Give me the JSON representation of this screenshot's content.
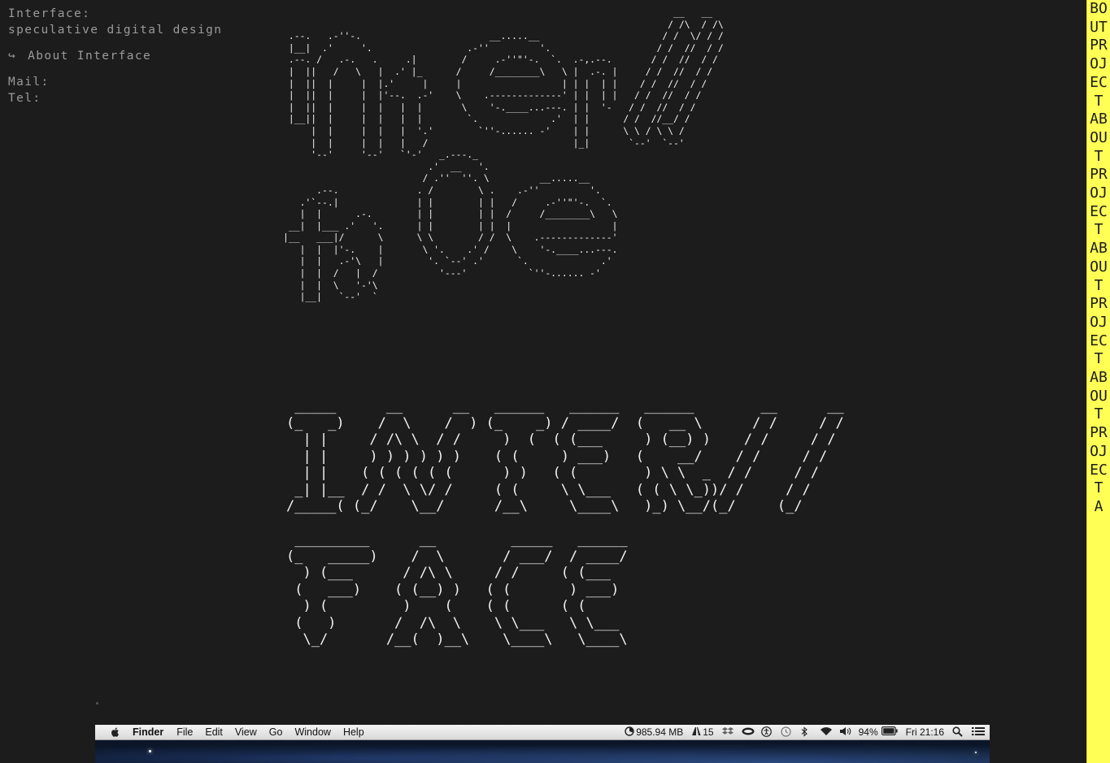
{
  "info": {
    "title": "Interface:",
    "subtitle": "speculative digital design",
    "about_arrow": "↪",
    "about_label": "About Interface",
    "mail_label": "Mail:",
    "tel_label": "Tel:"
  },
  "art": {
    "small": "                                                                      __   __\n                                                                     / /\\  / /\\\n .--.   .-''-.                       __.....__                      / /  \\/ / /\n |__|  .'     '.                 .-''         '.                   / /  //  / /\n .--. /   .-.   .     .|        /     .-''\"'-.  `.  .-,.--.       / /  //  / /\n |  ||   /   \\   |  .' |_      /     /________\\   \\ |  .-. |     / /  //  / /\n |  ||  |     |  |.'     |     |                  | | |  | |    / /  //  / /\n |  ||  |     |  |'--.  .-'    \\    .-------------' | |  | |   / /  //  / /\n |  ||  |     |  |   |  |       \\    '-.____...---. | |  '-   / /  //  / /\n |__||  |     |  |   |  |        `.             .'  | |      / /  //__/ /\n     |  |     |  |   |  '.'        `''-...... -'    | |      \\ \\ / \\ \\ /\n     |  |     |  |   |   /                          |_|       `--'  `--'\n     '--'     '--'   `'-'   _.---._\n                          .'  __   '.\n                         / .''  ''. \\         __.....__\n      .--.              . /        \\ .    .-''         '.\n   .'`--.|              | |        | |   /     .-''\"'-.  `.\n   |  |      .-.        | |        | |  /     /________\\   \\\n __|  |___ .'   '.      | |        | |  |                  |\n|__   ___|/      \\      \\ \\        / /  \\    .-------------'\n   |  |  |'-.    |       \\ '.    .' /    \\    '-.____...---.\n   |  |   .-'\\   |        '. `--' .'      `.             .'\n   |  |  /   |  /           '---'           `''-...... -'\n   |  |  \\   '-'\\\n   |__|   `--'  `",
    "big": " _____      __      __   ______   ______   ______        __      __\n(_   _)    /  \\    /  ) (_    _) / ____/  (   __ \\      / /     / /\n  | |     / /\\ \\  / /     )  (  ( (___     ) (__) )    / /     / /\n  | |     ) ) ) ) ) )    ( (     ) ___)   (    __/    / /     / /\n  | |    ( ( ( ( ( (      ) )   ( (        ) \\ \\  _  / /     / /\n _| |__  / /  \\ \\/ /     ( (     \\ \\___   ( ( \\ \\_))/ /     / /\n/_____( (_/    \\__/      /__\\     \\____\\   )_) \\__/(_/     (_/\n\n _________      __         _____   ______\n(_   _____)    /  \\       / ___/  / ____/\n  ) (___      / /\\ \\     / /     ( (___\n (   ___)    ( (__) )   ( (       ) ___)\n  ) (         )    (    ( (      ( (\n (   )       /  /\\  \\    \\ \\___   \\ \\___\n  \\_/       /__(  )__\\    \\____\\   \\____\\"
  },
  "strip": {
    "text": "BOUT PROJECT ABOUT PROJECT ABOUT PROJECT ABOUT PROJECT A"
  },
  "menubar": {
    "app_name": "Finder",
    "menus": [
      "File",
      "Edit",
      "View",
      "Go",
      "Window",
      "Help"
    ],
    "memory": "985.94 MB",
    "adobe_count": "15",
    "battery": "94%",
    "clock": "Fri 21:16",
    "icons": [
      "apple-icon",
      "memory-icon",
      "adobe-icon",
      "dropbox-icon",
      "eye-icon",
      "accessibility-icon",
      "time-machine-icon",
      "bluetooth-icon",
      "wifi-icon",
      "volume-icon",
      "battery-icon",
      "search-icon",
      "list-icon"
    ]
  },
  "colors": {
    "background": "#1c1c1c",
    "text_dim": "#9a9a9a",
    "art": "#f2f2f2",
    "strip": "#ffff55"
  }
}
